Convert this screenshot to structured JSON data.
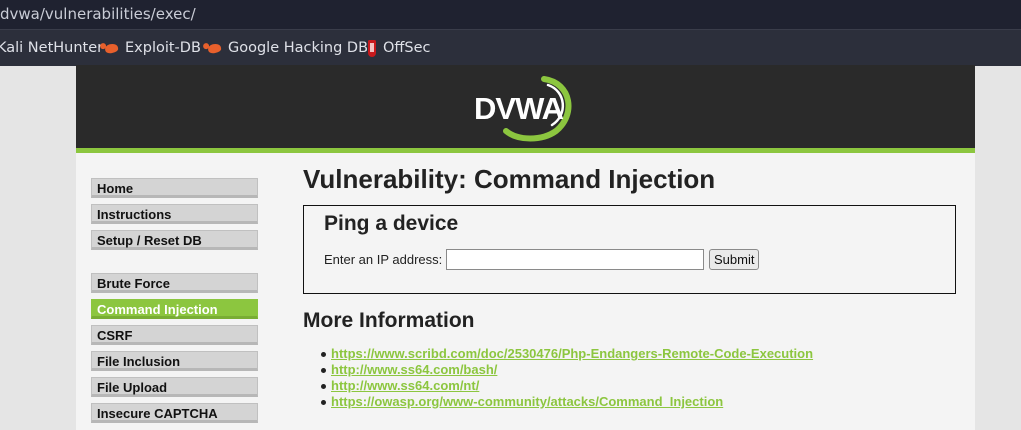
{
  "browser": {
    "url": "dvwa/vulnerabilities/exec/",
    "bookmarks": [
      {
        "label": "Kali NetHunter",
        "icon": "none"
      },
      {
        "label": "Exploit-DB",
        "icon": "dragon-icon"
      },
      {
        "label": "Google Hacking DB",
        "icon": "dragon-icon"
      },
      {
        "label": "OffSec",
        "icon": "offsec-icon"
      }
    ]
  },
  "header": {
    "logo_text": "DVWA",
    "colors": {
      "header_bg": "#2a2a2a",
      "accent": "#8cc63f"
    }
  },
  "sidebar": {
    "items": [
      {
        "label": "Home",
        "active": false
      },
      {
        "label": "Instructions",
        "active": false
      },
      {
        "label": "Setup / Reset DB",
        "active": false
      },
      {
        "label": "Brute Force",
        "active": false
      },
      {
        "label": "Command Injection",
        "active": true
      },
      {
        "label": "CSRF",
        "active": false
      },
      {
        "label": "File Inclusion",
        "active": false
      },
      {
        "label": "File Upload",
        "active": false
      },
      {
        "label": "Insecure CAPTCHA",
        "active": false
      }
    ]
  },
  "main": {
    "title": "Vulnerability: Command Injection",
    "form": {
      "heading": "Ping a device",
      "ip_label": "Enter an IP address:",
      "ip_value": "",
      "submit_label": "Submit"
    },
    "more_info": {
      "heading": "More Information",
      "links": [
        "https://www.scribd.com/doc/2530476/Php-Endangers-Remote-Code-Execution",
        "http://www.ss64.com/bash/",
        "http://www.ss64.com/nt/",
        "https://owasp.org/www-community/attacks/Command_Injection"
      ]
    }
  }
}
